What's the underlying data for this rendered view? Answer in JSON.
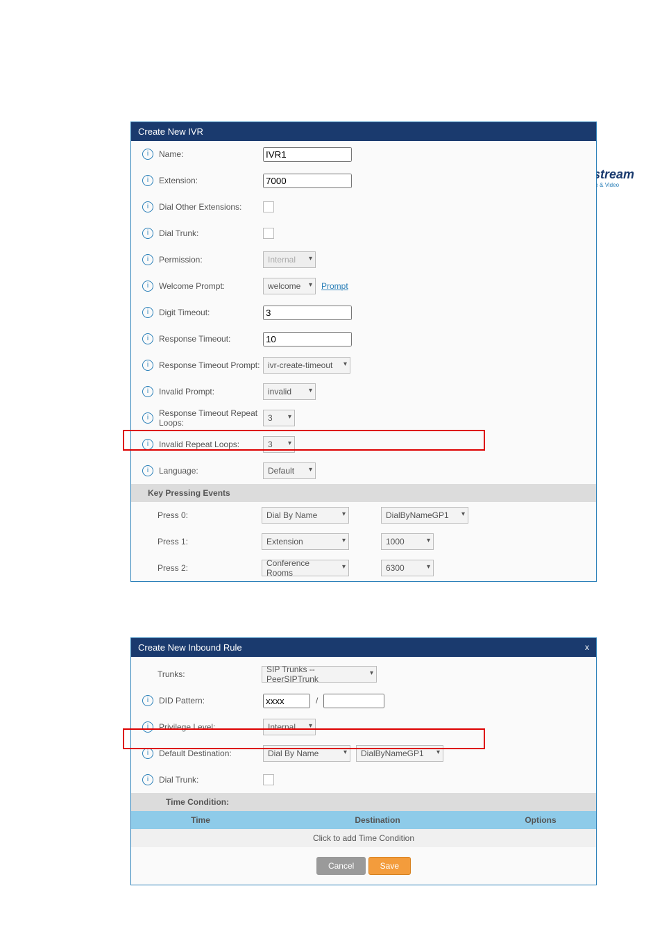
{
  "logo": {
    "brand": "Grandstream",
    "tagline": "Innovative IP Voice & Video"
  },
  "panel1": {
    "title": "Create New IVR",
    "fields": {
      "name": {
        "label": "Name:",
        "value": "IVR1"
      },
      "extension": {
        "label": "Extension:",
        "value": "7000"
      },
      "dial_other_ext": {
        "label": "Dial Other Extensions:"
      },
      "dial_trunk": {
        "label": "Dial Trunk:"
      },
      "permission": {
        "label": "Permission:",
        "value": "Internal"
      },
      "welcome_prompt": {
        "label": "Welcome Prompt:",
        "value": "welcome",
        "link": "Prompt"
      },
      "digit_timeout": {
        "label": "Digit Timeout:",
        "value": "3"
      },
      "response_timeout": {
        "label": "Response Timeout:",
        "value": "10"
      },
      "resp_to_prompt": {
        "label": "Response Timeout Prompt:",
        "value": "ivr-create-timeout"
      },
      "invalid_prompt": {
        "label": "Invalid Prompt:",
        "value": "invalid"
      },
      "resp_to_loops": {
        "label": "Response Timeout Repeat Loops:",
        "value": "3"
      },
      "invalid_loops": {
        "label": "Invalid Repeat Loops:",
        "value": "3"
      },
      "language": {
        "label": "Language:",
        "value": "Default"
      }
    },
    "key_events_header": "Key Pressing Events",
    "key_events": [
      {
        "label": "Press 0:",
        "action": "Dial By Name",
        "target": "DialByNameGP1"
      },
      {
        "label": "Press 1:",
        "action": "Extension",
        "target": "1000"
      },
      {
        "label": "Press 2:",
        "action": "Conference Rooms",
        "target": "6300"
      }
    ]
  },
  "panel2": {
    "title": "Create New Inbound Rule",
    "close": "x",
    "fields": {
      "trunks": {
        "label": "Trunks:",
        "value": "SIP Trunks -- PeerSIPTrunk"
      },
      "did_pattern": {
        "label": "DID Pattern:",
        "value": "xxxx",
        "sep": "/"
      },
      "privilege": {
        "label": "Privilege Level:",
        "value": "Internal"
      },
      "default_dest": {
        "label": "Default Destination:",
        "action": "Dial By Name",
        "target": "DialByNameGP1"
      },
      "dial_trunk": {
        "label": "Dial Trunk:"
      }
    },
    "tc_header": "Time Condition:",
    "tc_cols": {
      "time": "Time",
      "dest": "Destination",
      "opt": "Options"
    },
    "tc_add": "Click to add Time Condition",
    "buttons": {
      "cancel": "Cancel",
      "save": "Save"
    }
  }
}
